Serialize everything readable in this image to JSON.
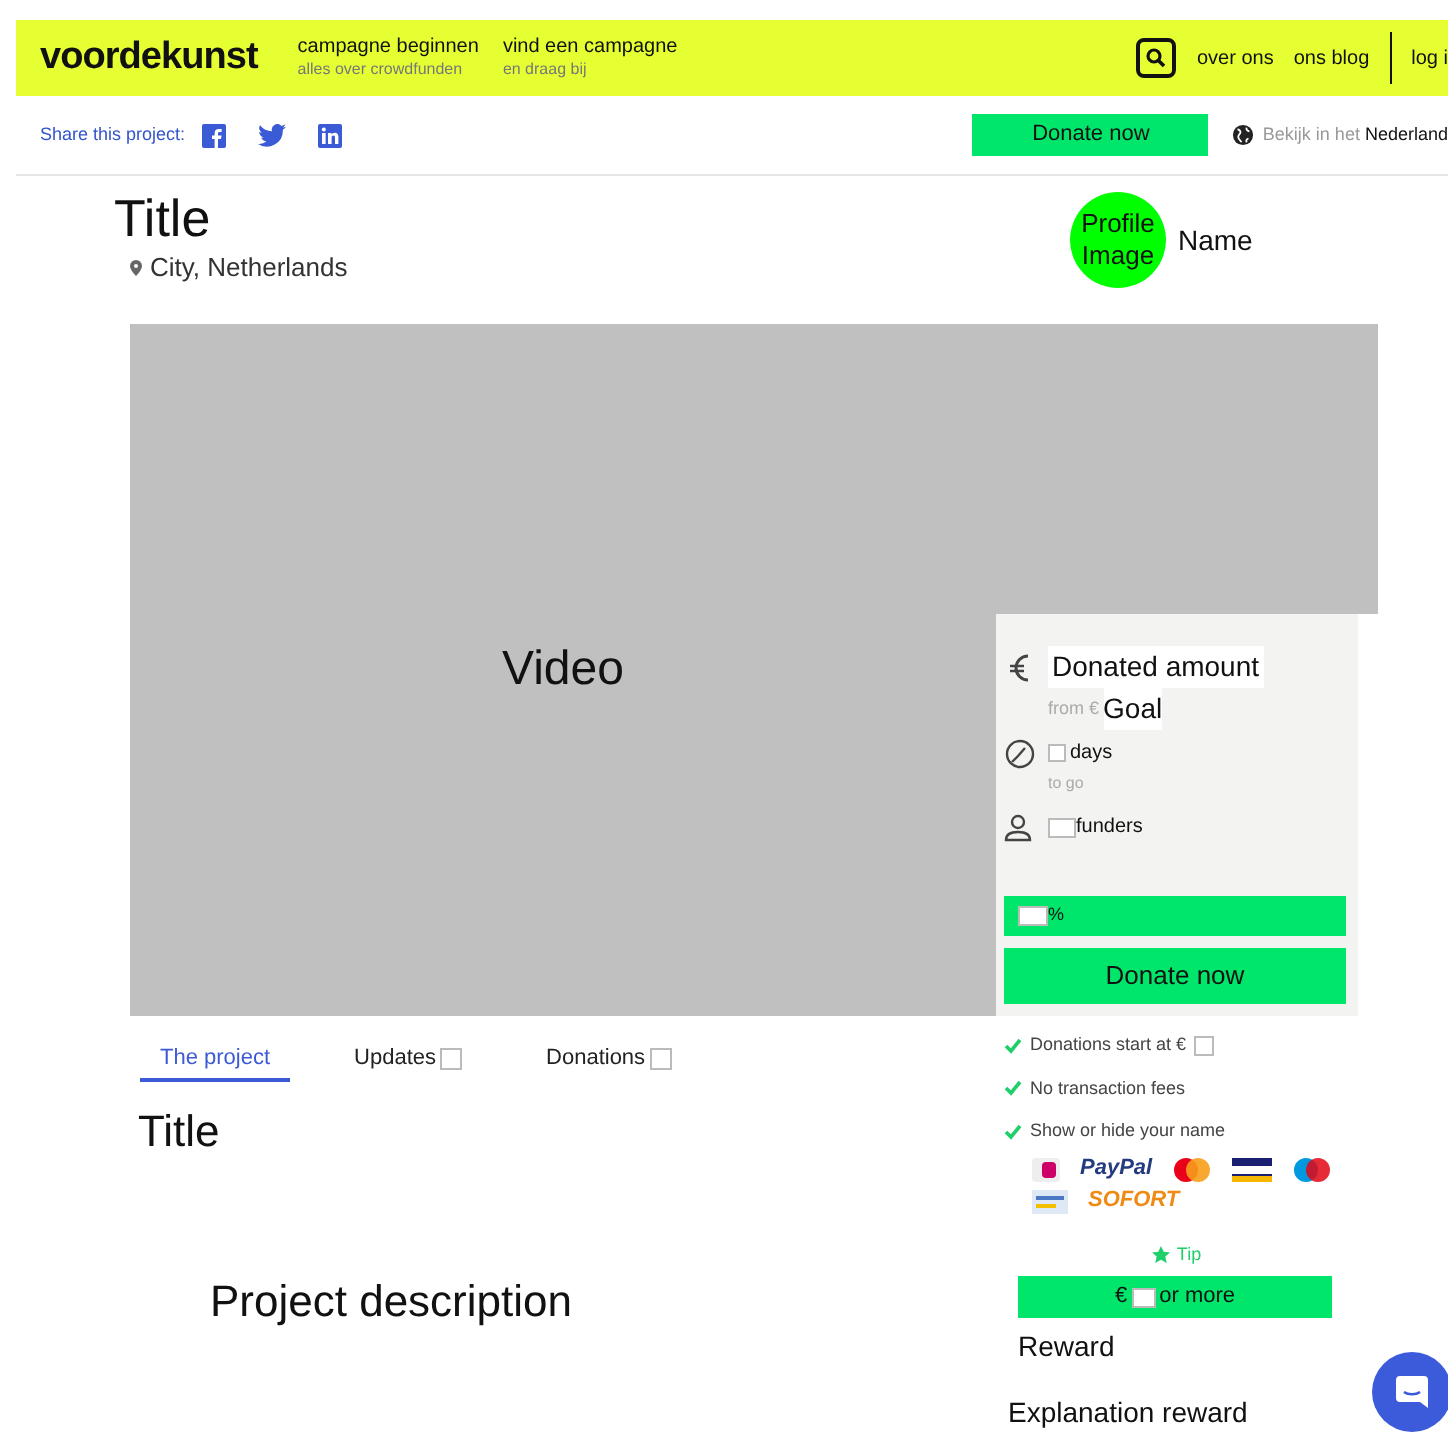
{
  "header": {
    "logo": "voordekunst",
    "nav": [
      {
        "label": "campagne beginnen",
        "sub": "alles over crowdfunden"
      },
      {
        "label": "vind een campagne",
        "sub": "en draag bij"
      }
    ],
    "links": [
      "over ons",
      "ons blog"
    ],
    "login": "log i"
  },
  "share": {
    "label": "Share this project:",
    "donate": "Donate now",
    "language_prefix": "Bekijk in het",
    "language": "Nederland"
  },
  "project": {
    "title": "Title",
    "location": "City, Netherlands",
    "profile_image": "Profile Image",
    "name": "Name"
  },
  "video": "Video",
  "stats": {
    "amount": "Donated amount",
    "from": "from €",
    "goal": "Goal",
    "days": "days",
    "to_go": "to go",
    "funders": "funders",
    "percent": "%",
    "level": 1,
    "donate": "Donate now"
  },
  "tabs": [
    {
      "label": "The project",
      "selected": true
    },
    {
      "label": "Updates",
      "selected": false
    },
    {
      "label": "Donations",
      "selected": false
    }
  ],
  "content": {
    "title": "Title",
    "description": "Project description"
  },
  "features": [
    "Donations start at €",
    "No transaction fees",
    "Show or hide your name"
  ],
  "payment_methods": [
    {
      "kind": "ideal"
    },
    {
      "kind": "wordmark",
      "label": "PayPal",
      "color": "#253b80"
    },
    {
      "kind": "mastercard"
    },
    {
      "kind": "visa"
    },
    {
      "kind": "maestro"
    },
    {
      "kind": "transfer"
    },
    {
      "kind": "wordmark",
      "label": "SOFORT",
      "color": "#ef8a14"
    }
  ],
  "tip": "Tip",
  "reward_button": {
    "prefix": "€",
    "suffix": "or more"
  },
  "reward": "Reward",
  "reward_explanation": "Explanation reward"
}
